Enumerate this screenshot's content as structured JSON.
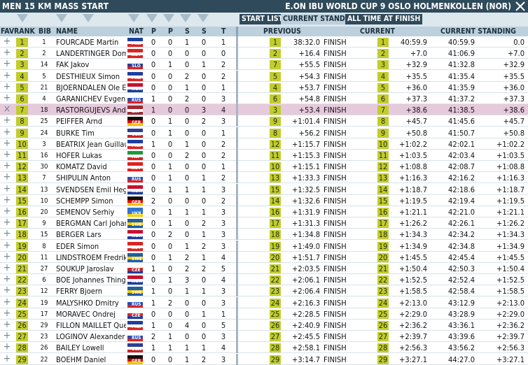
{
  "title_left": "MEN 15 KM MASS START",
  "title_right": "E.ON IBU WORLD CUP 9 OSLO HOLMENKOLLEN (NOR)",
  "view_buttons": [
    "START LIST",
    "CURRENT STANDING",
    "ALL TIMES",
    "AT FINISH"
  ],
  "headers": {
    "fav": "FAV",
    "rank": "RANK",
    "bib": "BIB",
    "name": "NAME",
    "nat": "NAT",
    "p1": "P",
    "p2": "P",
    "s1": "S",
    "s2": "S",
    "total": "T",
    "previous": "PREVIOUS",
    "current": "CURRENT",
    "standing": "CURRENT STANDING"
  },
  "colors": {
    "title": "#2f4a5a",
    "rank_bg": "#c2cd2c",
    "selected_row": "#e7c9dc",
    "header": "#bcd0dd"
  },
  "icons": {
    "add": "plus-icon",
    "remove": "cross-icon",
    "close": "close-icon",
    "filter": "triangle-down-icon"
  },
  "rows": [
    {
      "fav": "+",
      "rank": "1",
      "bib": "1",
      "name": "FOURCADE Martin",
      "nat": "FRA",
      "p1": "0",
      "p2": "0",
      "s1": "1",
      "s2": "0",
      "t": "1",
      "prev_rank": "1",
      "prev_time": "38:32.0",
      "status": "FINISH",
      "cur_rank": "1",
      "cur_time": "40:59.9",
      "stand_time": "40:59.9",
      "stand_diff": "0.0",
      "sel": false
    },
    {
      "fav": "+",
      "rank": "2",
      "bib": "2",
      "name": "LANDERTINGER Domi",
      "nat": "AUT",
      "p1": "0",
      "p2": "0",
      "s1": "0",
      "s2": "0",
      "t": "0",
      "prev_rank": "2",
      "prev_time": "+16.4",
      "status": "FINISH",
      "cur_rank": "2",
      "cur_time": "+7.0",
      "stand_time": "41:06.9",
      "stand_diff": "+7.0",
      "sel": false
    },
    {
      "fav": "+",
      "rank": "3",
      "bib": "14",
      "name": "FAK Jakov",
      "nat": "SLO",
      "p1": "0",
      "p2": "1",
      "s1": "0",
      "s2": "1",
      "t": "2",
      "prev_rank": "7",
      "prev_time": "+55.5",
      "status": "FINISH",
      "cur_rank": "3",
      "cur_time": "+32.9",
      "stand_time": "41:32.8",
      "stand_diff": "+32.9",
      "sel": false
    },
    {
      "fav": "+",
      "rank": "4",
      "bib": "5",
      "name": "DESTHIEUX Simon",
      "nat": "FRA",
      "p1": "0",
      "p2": "0",
      "s1": "2",
      "s2": "0",
      "t": "2",
      "prev_rank": "5",
      "prev_time": "+54.3",
      "status": "FINISH",
      "cur_rank": "4",
      "cur_time": "+35.5",
      "stand_time": "41:35.4",
      "stand_diff": "+35.5",
      "sel": false
    },
    {
      "fav": "+",
      "rank": "5",
      "bib": "21",
      "name": "BJOERNDALEN Ole Ein",
      "nat": "NOR",
      "p1": "0",
      "p2": "0",
      "s1": "1",
      "s2": "0",
      "t": "1",
      "prev_rank": "4",
      "prev_time": "+53.7",
      "status": "FINISH",
      "cur_rank": "5",
      "cur_time": "+36.0",
      "stand_time": "41:35.9",
      "stand_diff": "+36.0",
      "sel": false
    },
    {
      "fav": "+",
      "rank": "6",
      "bib": "4",
      "name": "GARANICHEV Evgeniy",
      "nat": "RUS",
      "p1": "1",
      "p2": "0",
      "s1": "2",
      "s2": "0",
      "t": "3",
      "prev_rank": "6",
      "prev_time": "+54.8",
      "status": "FINISH",
      "cur_rank": "6",
      "cur_time": "+37.3",
      "stand_time": "41:37.2",
      "stand_diff": "+37.3",
      "sel": false
    },
    {
      "fav": "×",
      "rank": "7",
      "bib": "18",
      "name": "RASTORGUJEVS Andre",
      "nat": "LAT",
      "p1": "1",
      "p2": "0",
      "s1": "0",
      "s2": "3",
      "t": "4",
      "prev_rank": "3",
      "prev_time": "+53.4",
      "status": "FINISH",
      "cur_rank": "7",
      "cur_time": "+38.6",
      "stand_time": "41:38.5",
      "stand_diff": "+38.6",
      "sel": true
    },
    {
      "fav": "+",
      "rank": "8",
      "bib": "25",
      "name": "PEIFFER Arnd",
      "nat": "GER",
      "p1": "0",
      "p2": "1",
      "s1": "0",
      "s2": "2",
      "t": "3",
      "prev_rank": "9",
      "prev_time": "+1:01.4",
      "status": "FINISH",
      "cur_rank": "8",
      "cur_time": "+45.7",
      "stand_time": "41:45.6",
      "stand_diff": "+45.7",
      "sel": false
    },
    {
      "fav": "+",
      "rank": "9",
      "bib": "24",
      "name": "BURKE Tim",
      "nat": "USA",
      "p1": "0",
      "p2": "1",
      "s1": "0",
      "s2": "0",
      "t": "1",
      "prev_rank": "8",
      "prev_time": "+56.2",
      "status": "FINISH",
      "cur_rank": "9",
      "cur_time": "+50.8",
      "stand_time": "41:50.7",
      "stand_diff": "+50.8",
      "sel": false
    },
    {
      "fav": "+",
      "rank": "10",
      "bib": "3",
      "name": "BEATRIX Jean Guillau",
      "nat": "FRA",
      "p1": "1",
      "p2": "0",
      "s1": "1",
      "s2": "0",
      "t": "2",
      "prev_rank": "12",
      "prev_time": "+1:15.7",
      "status": "FINISH",
      "cur_rank": "10",
      "cur_time": "+1:02.2",
      "stand_time": "42:02.1",
      "stand_diff": "+1:02.2",
      "sel": false
    },
    {
      "fav": "+",
      "rank": "11",
      "bib": "16",
      "name": "HOFER Lukas",
      "nat": "ITA",
      "p1": "0",
      "p2": "0",
      "s1": "2",
      "s2": "0",
      "t": "2",
      "prev_rank": "11",
      "prev_time": "+1:15.3",
      "status": "FINISH",
      "cur_rank": "11",
      "cur_time": "+1:03.5",
      "stand_time": "42:03.4",
      "stand_diff": "+1:03.5",
      "sel": false
    },
    {
      "fav": "+",
      "rank": "12",
      "bib": "30",
      "name": "KOMATZ David",
      "nat": "AUT",
      "p1": "0",
      "p2": "1",
      "s1": "0",
      "s2": "0",
      "t": "1",
      "prev_rank": "10",
      "prev_time": "+1:15.1",
      "status": "FINISH",
      "cur_rank": "12",
      "cur_time": "+1:08.8",
      "stand_time": "42:08.7",
      "stand_diff": "+1:08.8",
      "sel": false
    },
    {
      "fav": "+",
      "rank": "13",
      "bib": "7",
      "name": "SHIPULIN Anton",
      "nat": "RUS",
      "p1": "0",
      "p2": "1",
      "s1": "0",
      "s2": "1",
      "t": "2",
      "prev_rank": "13",
      "prev_time": "+1:33.3",
      "status": "FINISH",
      "cur_rank": "13",
      "cur_time": "+1:16.3",
      "stand_time": "42:16.2",
      "stand_diff": "+1:16.3",
      "sel": false
    },
    {
      "fav": "+",
      "rank": "14",
      "bib": "13",
      "name": "SVENDSEN Emil Hegle",
      "nat": "NOR",
      "p1": "0",
      "p2": "1",
      "s1": "1",
      "s2": "1",
      "t": "3",
      "prev_rank": "15",
      "prev_time": "+1:32.5",
      "status": "FINISH",
      "cur_rank": "14",
      "cur_time": "+1:18.7",
      "stand_time": "42:18.6",
      "stand_diff": "+1:18.7",
      "sel": false
    },
    {
      "fav": "+",
      "rank": "15",
      "bib": "10",
      "name": "SCHEMPP Simon",
      "nat": "GER",
      "p1": "2",
      "p2": "0",
      "s1": "0",
      "s2": "0",
      "t": "2",
      "prev_rank": "14",
      "prev_time": "+1:32.6",
      "status": "FINISH",
      "cur_rank": "15",
      "cur_time": "+1:19.5",
      "stand_time": "42:19.4",
      "stand_diff": "+1:19.5",
      "sel": false
    },
    {
      "fav": "+",
      "rank": "16",
      "bib": "20",
      "name": "SEMENOV Serhiy",
      "nat": "UKR",
      "p1": "0",
      "p2": "1",
      "s1": "1",
      "s2": "1",
      "t": "3",
      "prev_rank": "16",
      "prev_time": "+1:31.9",
      "status": "FINISH",
      "cur_rank": "16",
      "cur_time": "+1:21.1",
      "stand_time": "42:21.0",
      "stand_diff": "+1:21.1",
      "sel": false
    },
    {
      "fav": "+",
      "rank": "17",
      "bib": "9",
      "name": "BERGMAN Carl Johan",
      "nat": "SWE",
      "p1": "0",
      "p2": "1",
      "s1": "0",
      "s2": "2",
      "t": "3",
      "prev_rank": "17",
      "prev_time": "+1:31.3",
      "status": "FINISH",
      "cur_rank": "17",
      "cur_time": "+1:26.2",
      "stand_time": "42:26.1",
      "stand_diff": "+1:26.2",
      "sel": false
    },
    {
      "fav": "+",
      "rank": "18",
      "bib": "15",
      "name": "BERGER Lars",
      "nat": "NOR",
      "p1": "0",
      "p2": "2",
      "s1": "0",
      "s2": "1",
      "t": "3",
      "prev_rank": "18",
      "prev_time": "+1:34.8",
      "status": "FINISH",
      "cur_rank": "18",
      "cur_time": "+1:34.3",
      "stand_time": "42:34.2",
      "stand_diff": "+1:34.3",
      "sel": false
    },
    {
      "fav": "+",
      "rank": "19",
      "bib": "8",
      "name": "EDER Simon",
      "nat": "AUT",
      "p1": "0",
      "p2": "0",
      "s1": "1",
      "s2": "2",
      "t": "3",
      "prev_rank": "19",
      "prev_time": "+1:49.0",
      "status": "FINISH",
      "cur_rank": "19",
      "cur_time": "+1:34.9",
      "stand_time": "42:34.8",
      "stand_diff": "+1:34.9",
      "sel": false
    },
    {
      "fav": "+",
      "rank": "20",
      "bib": "11",
      "name": "LINDSTROEM Fredrik",
      "nat": "SWE",
      "p1": "0",
      "p2": "1",
      "s1": "2",
      "s2": "1",
      "t": "4",
      "prev_rank": "20",
      "prev_time": "+1:51.7",
      "status": "FINISH",
      "cur_rank": "20",
      "cur_time": "+1:45.5",
      "stand_time": "42:45.4",
      "stand_diff": "+1:45.5",
      "sel": false
    },
    {
      "fav": "+",
      "rank": "21",
      "bib": "27",
      "name": "SOUKUP Jaroslav",
      "nat": "CZE",
      "p1": "1",
      "p2": "0",
      "s1": "2",
      "s2": "2",
      "t": "5",
      "prev_rank": "21",
      "prev_time": "+2:03.5",
      "status": "FINISH",
      "cur_rank": "21",
      "cur_time": "+1:50.4",
      "stand_time": "42:50.3",
      "stand_diff": "+1:50.4",
      "sel": false
    },
    {
      "fav": "+",
      "rank": "22",
      "bib": "6",
      "name": "BOE Johannes Thingn",
      "nat": "NOR",
      "p1": "0",
      "p2": "1",
      "s1": "3",
      "s2": "0",
      "t": "4",
      "prev_rank": "22",
      "prev_time": "+2:06.1",
      "status": "FINISH",
      "cur_rank": "22",
      "cur_time": "+1:52.5",
      "stand_time": "42:52.4",
      "stand_diff": "+1:52.5",
      "sel": false
    },
    {
      "fav": "+",
      "rank": "23",
      "bib": "12",
      "name": "FERRY Bjoern",
      "nat": "SWE",
      "p1": "1",
      "p2": "0",
      "s1": "1",
      "s2": "1",
      "t": "3",
      "prev_rank": "23",
      "prev_time": "+2:06.4",
      "status": "FINISH",
      "cur_rank": "23",
      "cur_time": "+1:58.5",
      "stand_time": "42:58.4",
      "stand_diff": "+1:58.5",
      "sel": false
    },
    {
      "fav": "+",
      "rank": "24",
      "bib": "19",
      "name": "MALYSHKO Dmitry",
      "nat": "RUS",
      "p1": "1",
      "p2": "2",
      "s1": "0",
      "s2": "0",
      "t": "3",
      "prev_rank": "24",
      "prev_time": "+2:16.3",
      "status": "FINISH",
      "cur_rank": "24",
      "cur_time": "+2:13.0",
      "stand_time": "43:12.9",
      "stand_diff": "+2:13.0",
      "sel": false
    },
    {
      "fav": "+",
      "rank": "25",
      "bib": "17",
      "name": "MORAVEC Ondrej",
      "nat": "CZE",
      "p1": "0",
      "p2": "0",
      "s1": "0",
      "s2": "1",
      "t": "1",
      "prev_rank": "25",
      "prev_time": "+2:28.5",
      "status": "FINISH",
      "cur_rank": "25",
      "cur_time": "+2:29.0",
      "stand_time": "43:28.9",
      "stand_diff": "+2:29.0",
      "sel": false
    },
    {
      "fav": "+",
      "rank": "26",
      "bib": "29",
      "name": "FILLON MAILLET Que",
      "nat": "FRA",
      "p1": "1",
      "p2": "0",
      "s1": "4",
      "s2": "0",
      "t": "5",
      "prev_rank": "26",
      "prev_time": "+2:40.9",
      "status": "FINISH",
      "cur_rank": "26",
      "cur_time": "+2:36.2",
      "stand_time": "43:36.1",
      "stand_diff": "+2:36.2",
      "sel": false
    },
    {
      "fav": "+",
      "rank": "27",
      "bib": "23",
      "name": "LOGINOV Alexander",
      "nat": "RUS",
      "p1": "2",
      "p2": "1",
      "s1": "0",
      "s2": "0",
      "t": "3",
      "prev_rank": "27",
      "prev_time": "+2:45.5",
      "status": "FINISH",
      "cur_rank": "27",
      "cur_time": "+2:39.7",
      "stand_time": "43:39.6",
      "stand_diff": "+2:39.7",
      "sel": false
    },
    {
      "fav": "+",
      "rank": "28",
      "bib": "26",
      "name": "BAILEY Lowell",
      "nat": "USA",
      "p1": "1",
      "p2": "1",
      "s1": "1",
      "s2": "1",
      "t": "4",
      "prev_rank": "28",
      "prev_time": "+2:58.1",
      "status": "FINISH",
      "cur_rank": "28",
      "cur_time": "+2:56.3",
      "stand_time": "43:56.2",
      "stand_diff": "+2:56.3",
      "sel": false
    },
    {
      "fav": "+",
      "rank": "29",
      "bib": "22",
      "name": "BOEHM Daniel",
      "nat": "GER",
      "p1": "0",
      "p2": "0",
      "s1": "1",
      "s2": "2",
      "t": "3",
      "prev_rank": "29",
      "prev_time": "+3:14.7",
      "status": "FINISH",
      "cur_rank": "29",
      "cur_time": "+3:27.1",
      "stand_time": "44:27.0",
      "stand_diff": "+3:27.1",
      "sel": false
    }
  ]
}
